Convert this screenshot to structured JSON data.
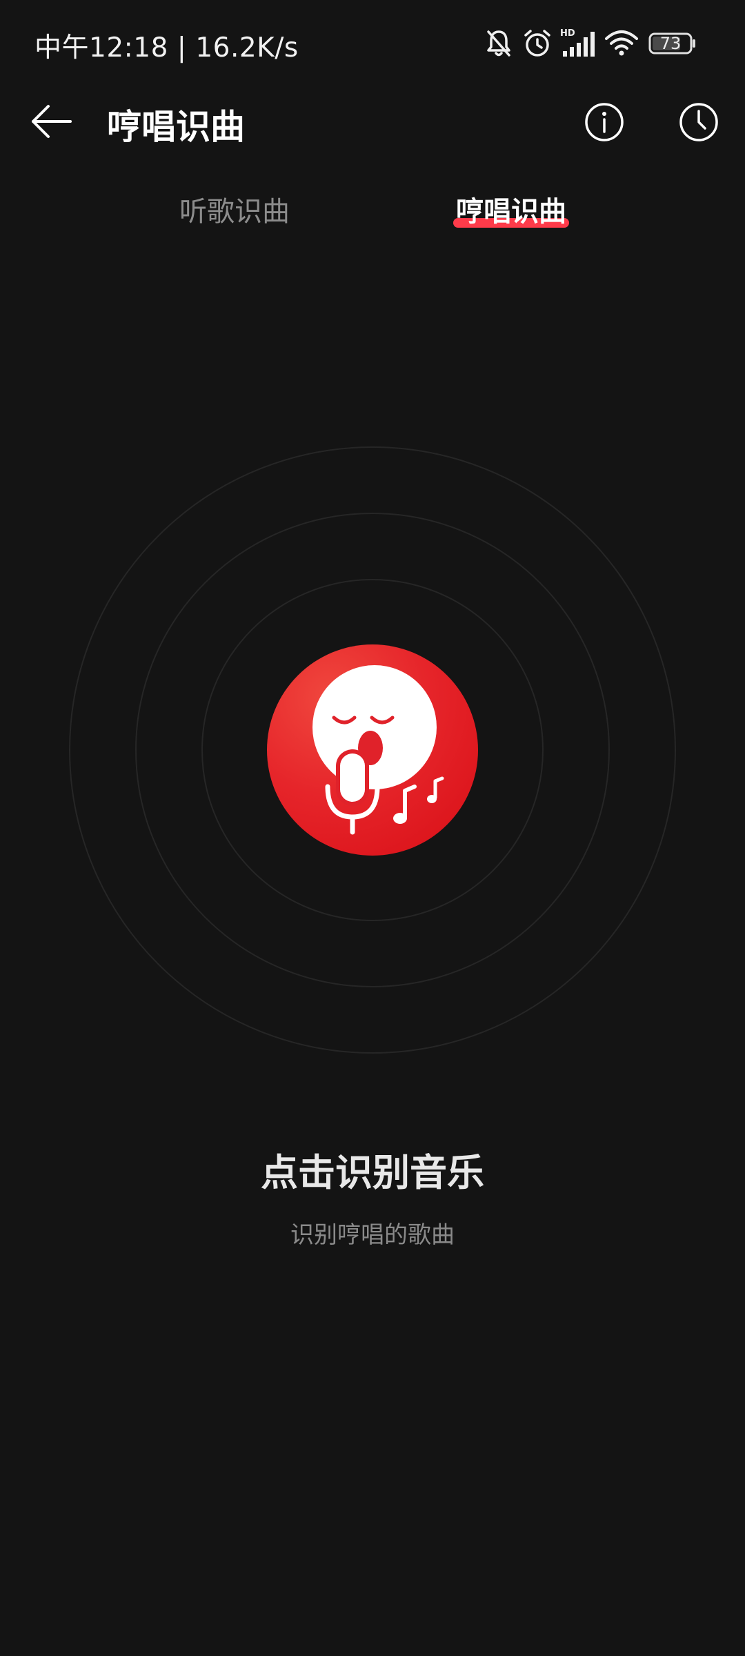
{
  "status_bar": {
    "text": "中午12:18 | 16.2K/s",
    "battery": "73"
  },
  "app_bar": {
    "title": "哼唱识曲"
  },
  "tabs": [
    {
      "label": "听歌识曲",
      "active": false
    },
    {
      "label": "哼唱识曲",
      "active": true
    }
  ],
  "prompt": {
    "title": "点击识别音乐",
    "subtitle": "识别哼唱的歌曲"
  },
  "colors": {
    "background": "#141414",
    "accent": "#e6252a",
    "tab_indicator": "#ff3b4a"
  }
}
